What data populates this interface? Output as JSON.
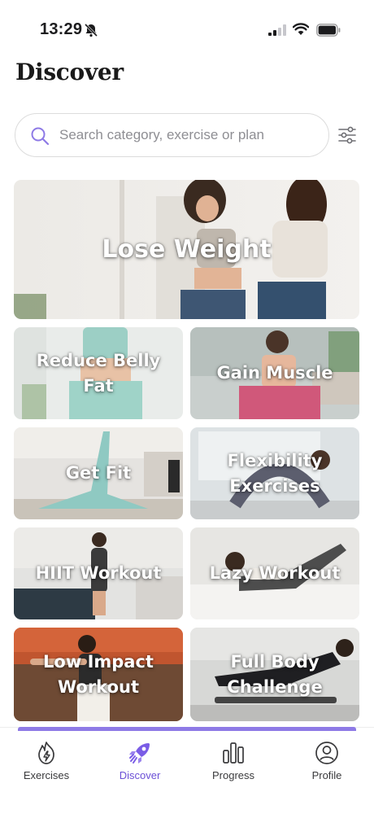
{
  "status_bar": {
    "time": "13:29"
  },
  "header": {
    "title": "Discover"
  },
  "search": {
    "placeholder": "Search category, exercise or plan",
    "value": ""
  },
  "featured": {
    "label": "Lose Weight"
  },
  "categories": [
    {
      "label": "Reduce Belly Fat"
    },
    {
      "label": "Gain Muscle"
    },
    {
      "label": "Get Fit"
    },
    {
      "label": "Flexibility\nExercises"
    },
    {
      "label": "HIIT Workout"
    },
    {
      "label": "Lazy Workout"
    },
    {
      "label": "Low Impact\nWorkout"
    },
    {
      "label": "Full Body\nChallenge"
    }
  ],
  "tabs": [
    {
      "label": "Exercises",
      "icon": "flame-icon"
    },
    {
      "label": "Discover",
      "icon": "rocket-icon",
      "active": true
    },
    {
      "label": "Progress",
      "icon": "bar-chart-icon"
    },
    {
      "label": "Profile",
      "icon": "user-icon"
    }
  ],
  "colors": {
    "accent": "#6b4fd6",
    "tab_inactive": "#3a3a3c"
  }
}
